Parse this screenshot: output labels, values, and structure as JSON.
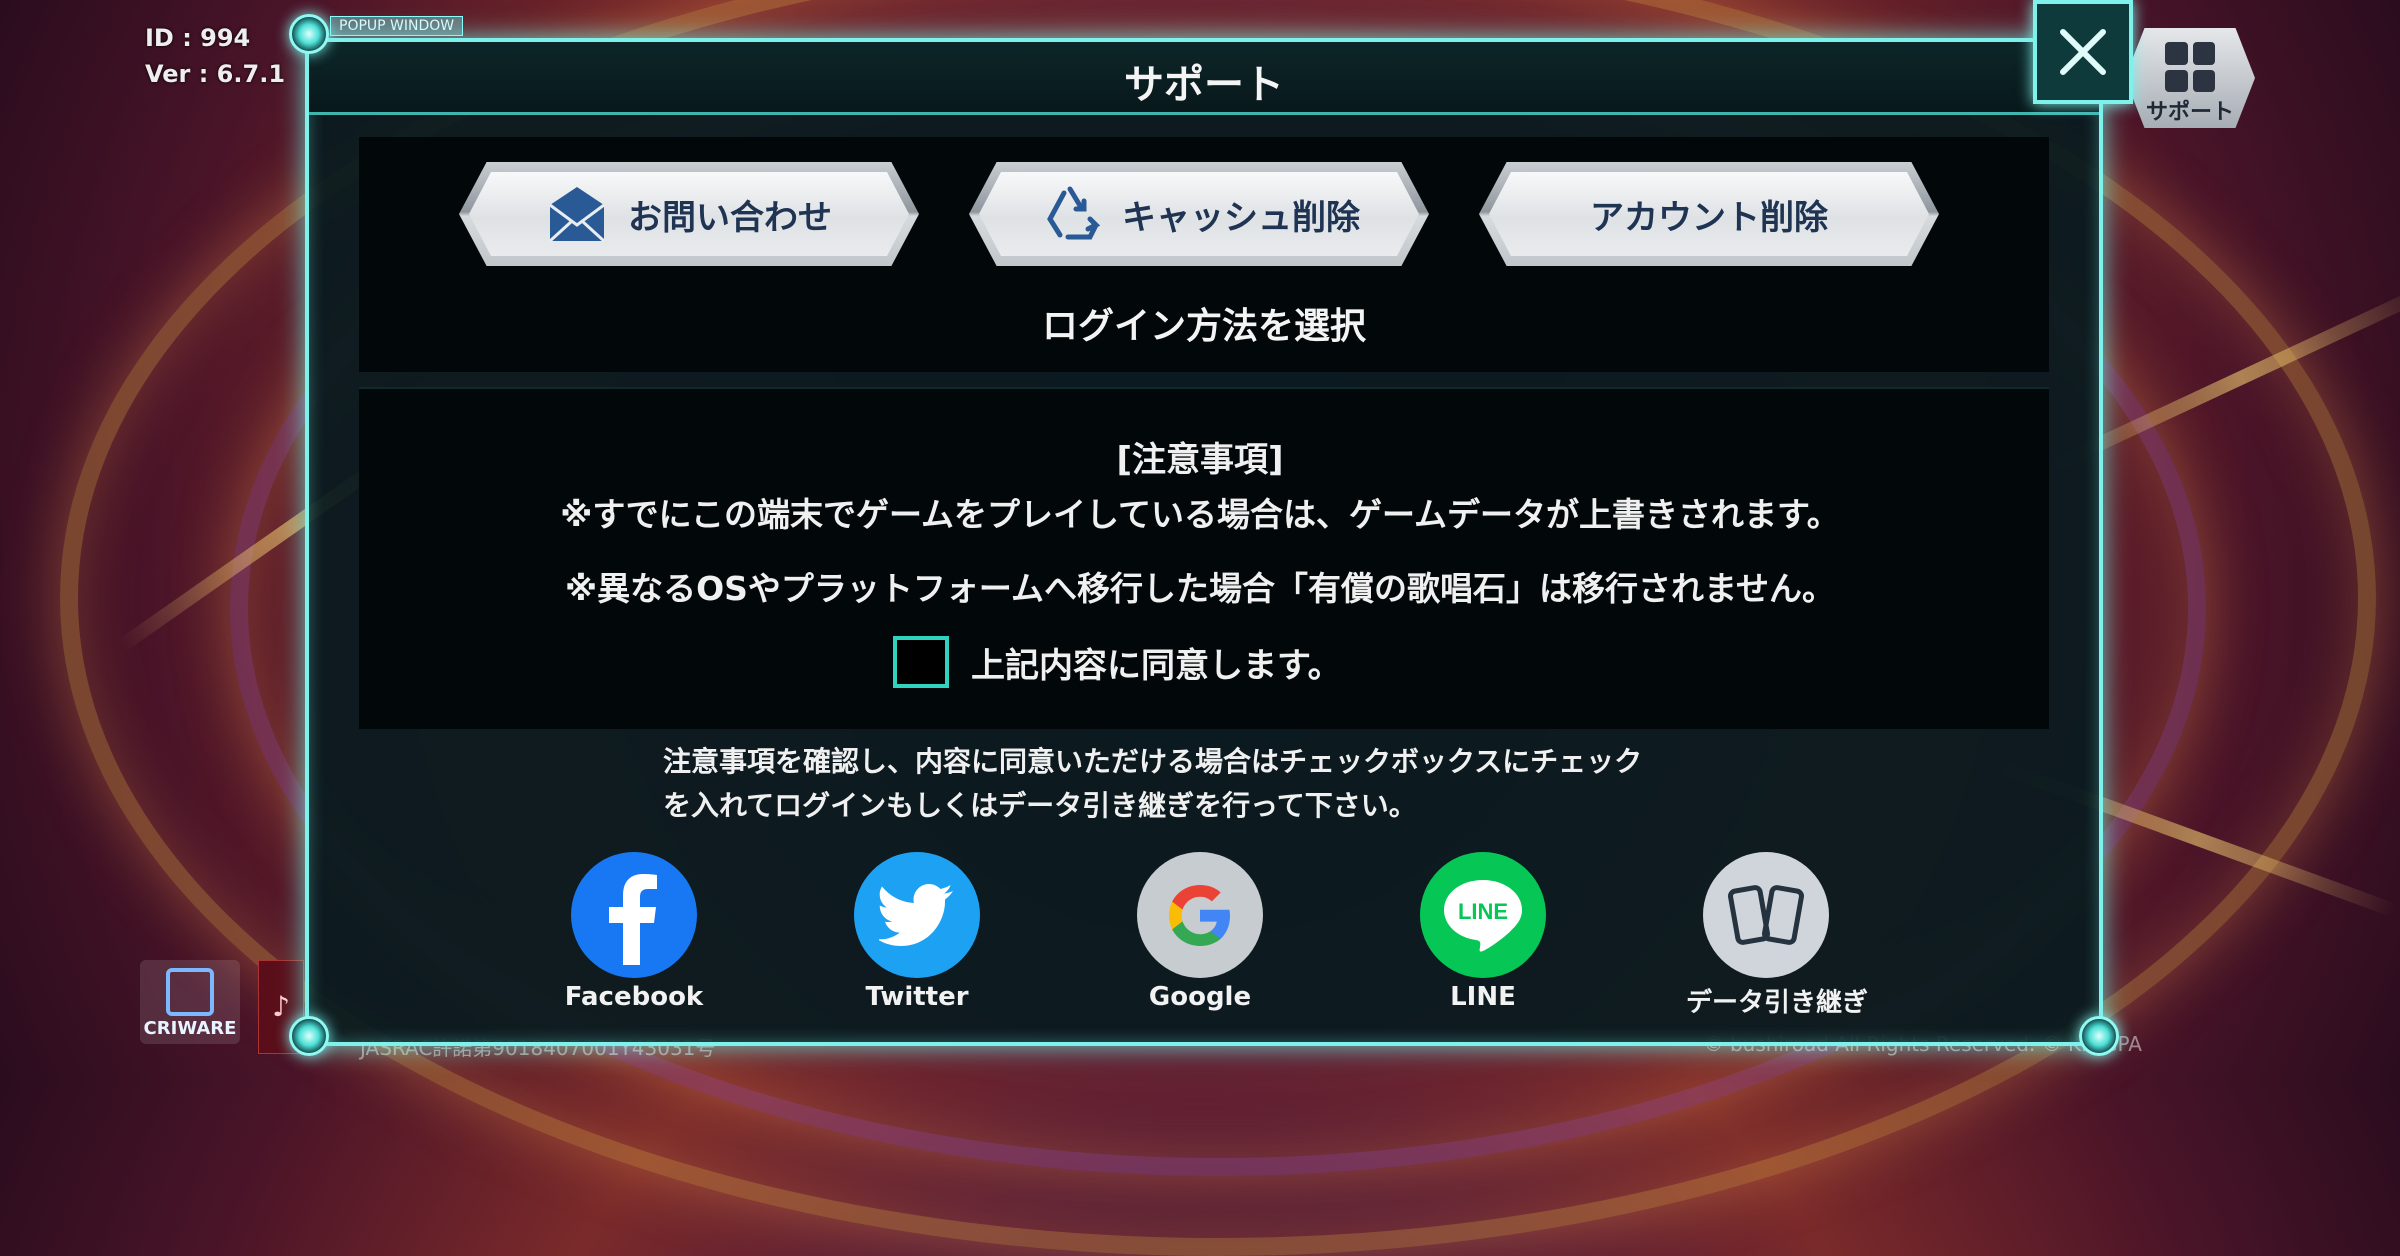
{
  "hud": {
    "id_line": "ID  : 994",
    "ver_line": "Ver : 6.7.1",
    "popup_tag": "POPUP WINDOW"
  },
  "corner_button": {
    "label": "サポート",
    "icon": "grid-icon"
  },
  "popup": {
    "title": "サポート",
    "close_icon": "close-icon",
    "buttons": [
      {
        "label": "お問い合わせ",
        "icon": "envelope-icon"
      },
      {
        "label": "キャッシュ削除",
        "icon": "recycle-icon"
      },
      {
        "label": "アカウント削除",
        "icon": ""
      }
    ],
    "login_method": "ログイン方法を選択",
    "notice": {
      "title": "[注意事項]",
      "line1": "※すでにこの端末でゲームをプレイしている場合は、ゲームデータが上書きされます。",
      "line2": "※異なるOSやプラットフォームへ移行した場合「有償の歌唱石」は移行されません。",
      "agree": "上記内容に同意します。",
      "agree_checked": false
    },
    "hint_line1": "注意事項を確認し、内容に同意いただける場合はチェックボックスにチェック",
    "hint_line2": "を入れてログインもしくはデータ引き継ぎを行って下さい。",
    "login_options": [
      {
        "label": "Facebook",
        "icon": "facebook-icon",
        "color": "#1877f2"
      },
      {
        "label": "Twitter",
        "icon": "twitter-icon",
        "color": "#1da1f2"
      },
      {
        "label": "Google",
        "icon": "google-icon",
        "color": "#ffffff"
      },
      {
        "label": "LINE",
        "icon": "line-icon",
        "color": "#06c755"
      },
      {
        "label": "データ引き継ぎ",
        "icon": "data-transfer-icon",
        "color": "#d9dee3"
      }
    ]
  },
  "footer": {
    "criware": "CRIWARE",
    "jasrac": "JASRAC許諾第9018407001Y43031号",
    "copyright": "© bushiroad All Rights Reserved. © KINGPA"
  }
}
